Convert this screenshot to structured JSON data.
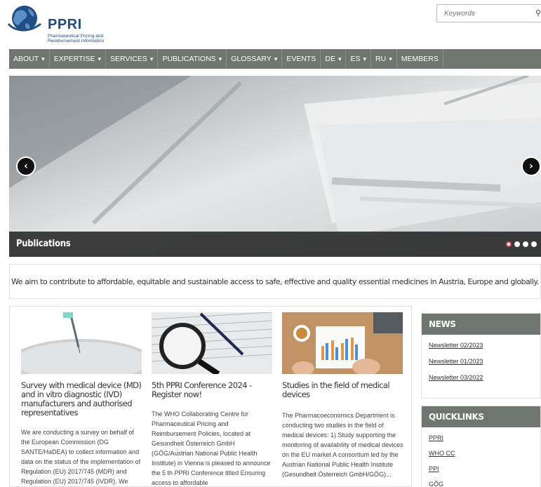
{
  "logo": {
    "title": "PPRI",
    "subtitle": "Pharmaceutical Pricing and Reimbursement Information"
  },
  "search": {
    "placeholder": "Keywords"
  },
  "nav": [
    {
      "label": "ABOUT",
      "dropdown": true
    },
    {
      "label": "EXPERTISE",
      "dropdown": true
    },
    {
      "label": "SERVICES",
      "dropdown": true
    },
    {
      "label": "PUBLICATIONS",
      "dropdown": true
    },
    {
      "label": "GLOSSARY",
      "dropdown": true
    },
    {
      "label": "EVENTS",
      "dropdown": false
    },
    {
      "label": "DE",
      "dropdown": true
    },
    {
      "label": "ES",
      "dropdown": true
    },
    {
      "label": "RU",
      "dropdown": true
    },
    {
      "label": "MEMBERS",
      "dropdown": false
    }
  ],
  "carousel": {
    "caption": "Publications",
    "prev_icon": "chevron-left-icon",
    "next_icon": "chevron-right-icon",
    "slide_count": 4,
    "active_slide": 1
  },
  "mission": "We aim to contribute to affordable, equitable and sustainable access to safe, effective and quality essential medicines in Austria, Europe and globally.",
  "cards": [
    {
      "title": "Survey with medical device (MD) and in vitro diagnostic (IVD) manufacturers and authorised representatives",
      "text": "We are conducting a survey on behalf of the European Commission (DG SANTE/HaDEA) to collect information and data on the status of the implementation of Regulation (EU) 2017/745 (MDR) and Regulation (EU) 2017/745 (IVDR). We kindly ask all manufacturers and"
    },
    {
      "title": "5th PPRI Conference 2024 - Register now!",
      "text": "The WHO Collaborating Centre for Pharmaceutical Pricing and Reimbursement Policies, located at Gesundheit Österreich GmbH (GÖG/Austrian National Public Health Institute) in Vienna is pleased to announce the 5 th PPRI Conference titled Ensuring access to affordable"
    },
    {
      "title": "Studies in the field of medical devices",
      "text": "The Pharmacoeconomics Department is conducting two studies in the field of medical devices: 1) Study supporting the monitoring of availability of medical devices on the EU market A consortium led by the Austrian National Public Health Institute (Gesundheit Österreich GmbH/GÖG)..."
    }
  ],
  "news": {
    "heading": "NEWS",
    "items": [
      "Newsletter 02/2023",
      "Newsletter 01/2023",
      "Newsletter 03/2022"
    ]
  },
  "quicklinks": {
    "heading": "QUICKLINKS",
    "items": [
      "PPRI",
      "WHO CC",
      "PPI",
      "GÖG"
    ]
  }
}
